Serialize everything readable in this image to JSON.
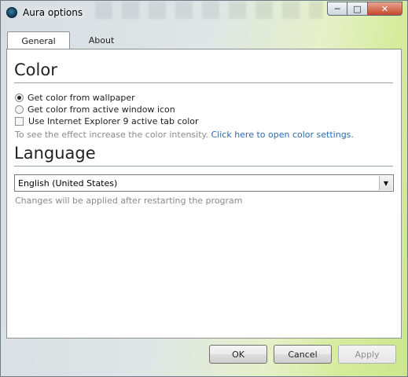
{
  "window": {
    "title": "Aura options",
    "icon": "aura-app-icon",
    "caption_buttons": {
      "minimize": "─",
      "maximize": "□",
      "close": "✕"
    }
  },
  "tabs": [
    {
      "label": "General",
      "selected": true
    },
    {
      "label": "About",
      "selected": false
    }
  ],
  "color_section": {
    "heading": "Color",
    "options": [
      {
        "label": "Get color from wallpaper",
        "type": "radio",
        "checked": true
      },
      {
        "label": "Get color from active window icon",
        "type": "radio",
        "checked": false
      },
      {
        "label": "Use Internet Explorer 9 active tab color",
        "type": "checkbox",
        "checked": false
      }
    ],
    "hint": "To see the effect increase the color intensity.",
    "link": "Click here to open color settings."
  },
  "language_section": {
    "heading": "Language",
    "selected_language": "English (United States)",
    "note": "Changes will be applied after restarting the program"
  },
  "footer": {
    "ok_label": "OK",
    "cancel_label": "Cancel",
    "apply_label": "Apply",
    "apply_enabled": false
  },
  "colors": {
    "link": "#2a6bb4",
    "hint_text": "#8a8a8a",
    "close_button": "#c6482d"
  }
}
